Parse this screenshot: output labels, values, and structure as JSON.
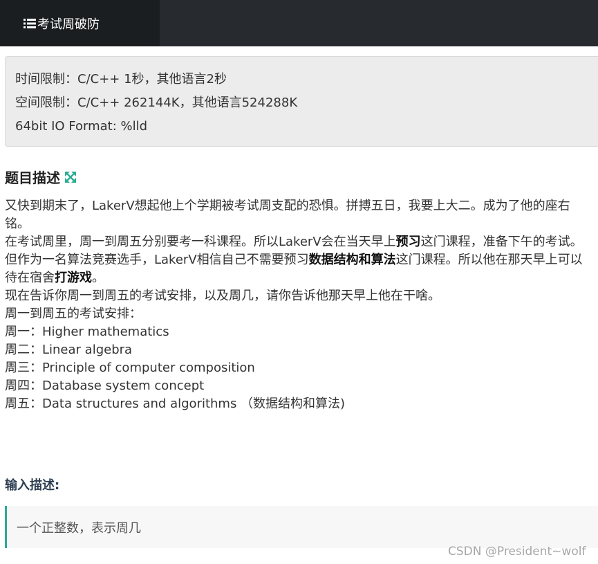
{
  "nav": {
    "title": "考试周破防",
    "icon": "list-icon"
  },
  "limits": {
    "time": "时间限制：C/C++ 1秒，其他语言2秒",
    "space": "空间限制：C/C++ 262144K，其他语言524288K",
    "io_format": "64bit IO Format: %lld"
  },
  "description": {
    "title": "题目描述",
    "expand_icon": "expand-icon",
    "p1": "又快到期末了，LakerV想起他上个学期被考试周支配的恐惧。拼搏五日，我要上大二。成为了他的座右铭。",
    "p2_a": "在考试周里，周一到周五分别要考一科课程。所以LakerV会在当天早上",
    "p2_b": "预习",
    "p2_c": "这门课程，准备下午的考试。但作为一名算法竞赛选手，LakerV相信自己不需要预习",
    "p2_d": "数据结构和算法",
    "p2_e": "这门课程。所以他在那天早上可以待在宿舍",
    "p2_f": "打游戏",
    "p2_g": "。",
    "p3": "现在告诉你周一到周五的考试安排，以及周几，请你告诉他那天早上他在干啥。",
    "p4": "周一到周五的考试安排：",
    "schedule": [
      "周一：Higher mathematics",
      "周二：Linear algebra",
      "周三：Principle of computer composition",
      "周四：Database system concept",
      "周五：Data structures and algorithms （数据结构和算法)"
    ]
  },
  "input": {
    "title": "输入描述:",
    "text": "一个正整数，表示周几"
  },
  "watermark": "CSDN @President~wolf",
  "colors": {
    "nav_bg": "#272b30",
    "nav_tab_bg": "#1b1e21",
    "accent": "#2bab93"
  }
}
